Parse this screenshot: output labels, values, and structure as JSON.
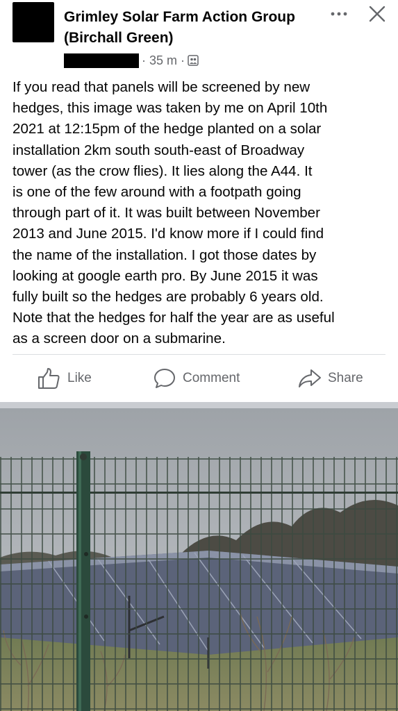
{
  "post": {
    "group_name": "Grimley Solar Farm Action Group (Birchall Green)",
    "time": "· 35 m ·",
    "audience_icon": "group-icon",
    "text": "If you read that panels will be screened by new\nhedges, this image was taken by me on April 10th\n2021 at 12:15pm of the hedge planted on a solar\ninstallation 2km south south-east of Broadway\ntower (as the crow flies).  It lies along the A44.   It\nis one of the few around with a footpath going\nthrough part of it. It was built between November\n2013 and June 2015.  I'd know more if I could find\nthe name of the installation.  I got those dates by\nlooking at google earth pro.  By June 2015  it was\nfully built so the hedges are probably 6 years old.\nNote that the hedges for half the year are as useful\nas a screen door on a submarine."
  },
  "actions": {
    "like": "Like",
    "comment": "Comment",
    "share": "Share"
  },
  "colors": {
    "secondary_text": "#65676b",
    "divider": "#dadde1",
    "separator": "#c9ccd1"
  }
}
